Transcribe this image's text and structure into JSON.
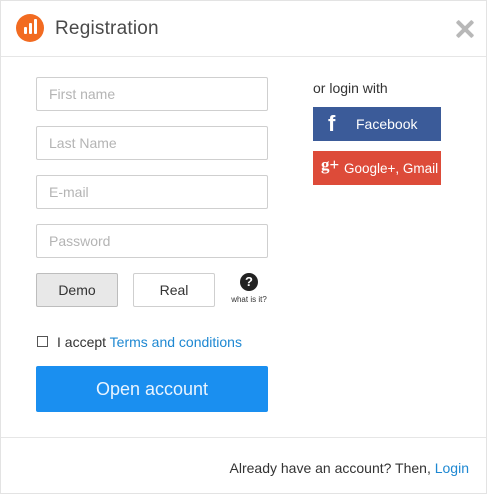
{
  "header": {
    "title": "Registration",
    "logo_icon": "chart-bars-logo-icon",
    "close_icon": "close-icon",
    "brand_color": "#f26b21"
  },
  "form": {
    "first_name_placeholder": "First name",
    "last_name_placeholder": "Last Name",
    "email_placeholder": "E-mail",
    "password_placeholder": "Password",
    "account_types": [
      "Demo",
      "Real"
    ],
    "selected_account_type": "Demo",
    "help_icon": "question-circle-icon",
    "help_text": "what is it?",
    "accept_prefix": "I accept",
    "terms_link": "Terms and conditions",
    "terms_checked": false,
    "submit_label": "Open account",
    "submit_color": "#1a8ff0"
  },
  "social": {
    "heading": "or login with",
    "facebook_icon": "f",
    "facebook_label": "Facebook",
    "facebook_color": "#3b5b99",
    "google_icon": "g+",
    "google_label": "Google+, Gmail",
    "google_color": "#dd4b39"
  },
  "footer": {
    "text": "Already have an account? Then,",
    "login_link": "Login",
    "link_color": "#1e88d2"
  }
}
